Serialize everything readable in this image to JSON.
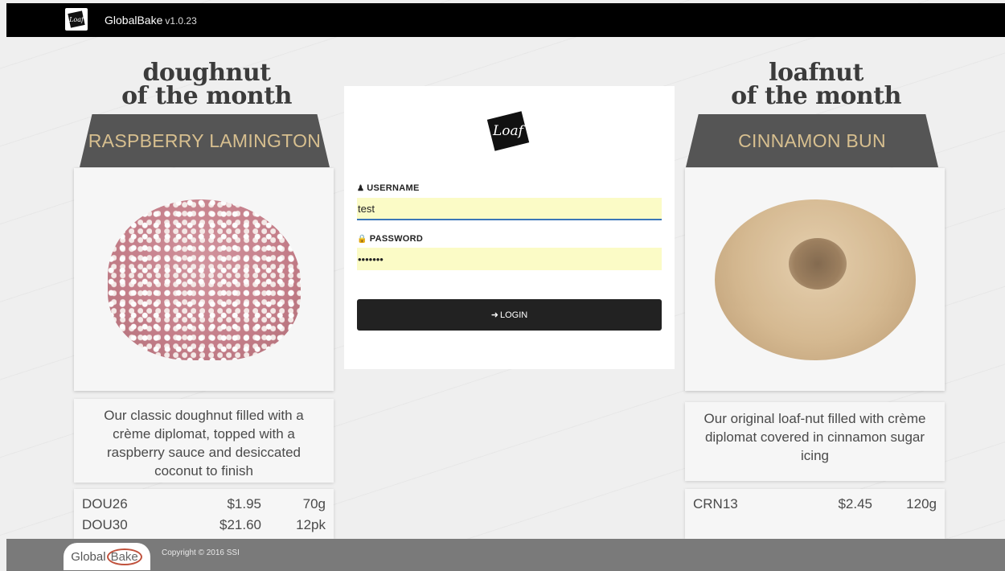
{
  "app": {
    "title": "GlobalBake",
    "version": "v1.0.23",
    "logo_icon": "loaf-logo-icon"
  },
  "left_promo": {
    "heading_line1": "doughnut",
    "heading_line2": "of the month",
    "product_name": "RASPBERRY LAMINGTON",
    "image_icon": "raspberry-lamington-doughnut-image",
    "description": "Our classic doughnut filled with a crème diplomat, topped with a raspberry sauce and desiccated coconut to finish",
    "skus": [
      {
        "code": "DOU26",
        "price": "$1.95",
        "size": "70g"
      },
      {
        "code": "DOU30",
        "price": "$21.60",
        "size": "12pk"
      }
    ]
  },
  "right_promo": {
    "heading_line1": "loafnut",
    "heading_line2": "of the month",
    "product_name": "CINNAMON BUN",
    "image_icon": "cinnamon-bun-loafnut-image",
    "description": "Our original loaf-nut filled with crème diplomat covered in cinnamon sugar icing",
    "skus": [
      {
        "code": "CRN13",
        "price": "$2.45",
        "size": "120g"
      }
    ]
  },
  "login": {
    "brand_mark": "Loaf",
    "username_label": "USERNAME",
    "username_value": "test",
    "password_label": "PASSWORD",
    "password_value": "•••••••",
    "login_label": "LOGIN",
    "user_icon": "user-icon",
    "lock_icon": "lock-icon",
    "sign_in_icon": "sign-in-icon"
  },
  "footer": {
    "logo_text_left": "Global",
    "logo_text_right": "Bake",
    "copyright": "Copyright © 2016 SSI"
  },
  "colors": {
    "topbar": "#000000",
    "banner": "#555555",
    "banner_text": "#d7bf8f",
    "input_autofill": "#fbfbc6",
    "input_focus": "#3b77b8",
    "login_button": "#222222",
    "footer": "#7a7a7a"
  }
}
